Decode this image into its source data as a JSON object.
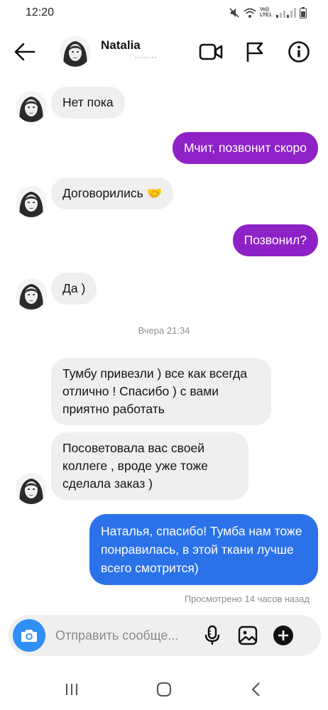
{
  "status_bar": {
    "time": "12:20",
    "network_label": "Vo)) LTE1"
  },
  "header": {
    "contact_name": "Natalia",
    "icons": [
      "back-arrow-icon",
      "video-camera-icon",
      "flag-icon",
      "info-icon"
    ]
  },
  "messages": [
    {
      "direction": "in",
      "text": "Нет пока"
    },
    {
      "direction": "out",
      "text": "Мчит, позвонит скоро"
    },
    {
      "direction": "in",
      "text": "Договорились 🤝"
    },
    {
      "direction": "out",
      "text": "Позвонил?"
    },
    {
      "direction": "in",
      "text": "Да )"
    },
    {
      "direction": "in",
      "text": "Тумбу привезли ) все как всегда отлично ! Спасибо ) с вами приятно работать"
    },
    {
      "direction": "in",
      "text": "Посоветовала вас своей коллеге , вроде уже тоже сделала заказ )"
    },
    {
      "direction": "out",
      "text": "Наталья, спасибо! Тумба нам тоже понравилась, в этой ткани лучше всего смотрится)"
    }
  ],
  "timestamp_divider": "Вчера 21:34",
  "seen_status": "Просмотрено 14 часов назад",
  "composer": {
    "placeholder": "Отправить сообще...",
    "icons": [
      "camera-icon",
      "microphone-icon",
      "gallery-icon",
      "plus-icon"
    ]
  },
  "colors": {
    "outgoing_purple": "#8e22c7",
    "outgoing_blue": "#2b72e8",
    "incoming_gray": "#efefef",
    "camera_blue": "#2f8ff5"
  },
  "navbar": {
    "icons": [
      "recent-apps-icon",
      "home-icon",
      "back-icon"
    ]
  }
}
